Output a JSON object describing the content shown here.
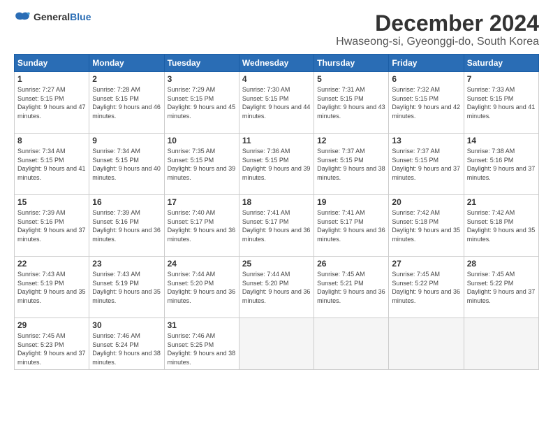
{
  "logo": {
    "general": "General",
    "blue": "Blue"
  },
  "title": "December 2024",
  "location": "Hwaseong-si, Gyeonggi-do, South Korea",
  "weekdays": [
    "Sunday",
    "Monday",
    "Tuesday",
    "Wednesday",
    "Thursday",
    "Friday",
    "Saturday"
  ],
  "weeks": [
    [
      {
        "day": "1",
        "sunrise": "7:27 AM",
        "sunset": "5:15 PM",
        "daylight": "9 hours and 47 minutes."
      },
      {
        "day": "2",
        "sunrise": "7:28 AM",
        "sunset": "5:15 PM",
        "daylight": "9 hours and 46 minutes."
      },
      {
        "day": "3",
        "sunrise": "7:29 AM",
        "sunset": "5:15 PM",
        "daylight": "9 hours and 45 minutes."
      },
      {
        "day": "4",
        "sunrise": "7:30 AM",
        "sunset": "5:15 PM",
        "daylight": "9 hours and 44 minutes."
      },
      {
        "day": "5",
        "sunrise": "7:31 AM",
        "sunset": "5:15 PM",
        "daylight": "9 hours and 43 minutes."
      },
      {
        "day": "6",
        "sunrise": "7:32 AM",
        "sunset": "5:15 PM",
        "daylight": "9 hours and 42 minutes."
      },
      {
        "day": "7",
        "sunrise": "7:33 AM",
        "sunset": "5:15 PM",
        "daylight": "9 hours and 41 minutes."
      }
    ],
    [
      {
        "day": "8",
        "sunrise": "7:34 AM",
        "sunset": "5:15 PM",
        "daylight": "9 hours and 41 minutes."
      },
      {
        "day": "9",
        "sunrise": "7:34 AM",
        "sunset": "5:15 PM",
        "daylight": "9 hours and 40 minutes."
      },
      {
        "day": "10",
        "sunrise": "7:35 AM",
        "sunset": "5:15 PM",
        "daylight": "9 hours and 39 minutes."
      },
      {
        "day": "11",
        "sunrise": "7:36 AM",
        "sunset": "5:15 PM",
        "daylight": "9 hours and 39 minutes."
      },
      {
        "day": "12",
        "sunrise": "7:37 AM",
        "sunset": "5:15 PM",
        "daylight": "9 hours and 38 minutes."
      },
      {
        "day": "13",
        "sunrise": "7:37 AM",
        "sunset": "5:15 PM",
        "daylight": "9 hours and 37 minutes."
      },
      {
        "day": "14",
        "sunrise": "7:38 AM",
        "sunset": "5:16 PM",
        "daylight": "9 hours and 37 minutes."
      }
    ],
    [
      {
        "day": "15",
        "sunrise": "7:39 AM",
        "sunset": "5:16 PM",
        "daylight": "9 hours and 37 minutes."
      },
      {
        "day": "16",
        "sunrise": "7:39 AM",
        "sunset": "5:16 PM",
        "daylight": "9 hours and 36 minutes."
      },
      {
        "day": "17",
        "sunrise": "7:40 AM",
        "sunset": "5:17 PM",
        "daylight": "9 hours and 36 minutes."
      },
      {
        "day": "18",
        "sunrise": "7:41 AM",
        "sunset": "5:17 PM",
        "daylight": "9 hours and 36 minutes."
      },
      {
        "day": "19",
        "sunrise": "7:41 AM",
        "sunset": "5:17 PM",
        "daylight": "9 hours and 36 minutes."
      },
      {
        "day": "20",
        "sunrise": "7:42 AM",
        "sunset": "5:18 PM",
        "daylight": "9 hours and 35 minutes."
      },
      {
        "day": "21",
        "sunrise": "7:42 AM",
        "sunset": "5:18 PM",
        "daylight": "9 hours and 35 minutes."
      }
    ],
    [
      {
        "day": "22",
        "sunrise": "7:43 AM",
        "sunset": "5:19 PM",
        "daylight": "9 hours and 35 minutes."
      },
      {
        "day": "23",
        "sunrise": "7:43 AM",
        "sunset": "5:19 PM",
        "daylight": "9 hours and 35 minutes."
      },
      {
        "day": "24",
        "sunrise": "7:44 AM",
        "sunset": "5:20 PM",
        "daylight": "9 hours and 36 minutes."
      },
      {
        "day": "25",
        "sunrise": "7:44 AM",
        "sunset": "5:20 PM",
        "daylight": "9 hours and 36 minutes."
      },
      {
        "day": "26",
        "sunrise": "7:45 AM",
        "sunset": "5:21 PM",
        "daylight": "9 hours and 36 minutes."
      },
      {
        "day": "27",
        "sunrise": "7:45 AM",
        "sunset": "5:22 PM",
        "daylight": "9 hours and 36 minutes."
      },
      {
        "day": "28",
        "sunrise": "7:45 AM",
        "sunset": "5:22 PM",
        "daylight": "9 hours and 37 minutes."
      }
    ],
    [
      {
        "day": "29",
        "sunrise": "7:45 AM",
        "sunset": "5:23 PM",
        "daylight": "9 hours and 37 minutes."
      },
      {
        "day": "30",
        "sunrise": "7:46 AM",
        "sunset": "5:24 PM",
        "daylight": "9 hours and 38 minutes."
      },
      {
        "day": "31",
        "sunrise": "7:46 AM",
        "sunset": "5:25 PM",
        "daylight": "9 hours and 38 minutes."
      },
      null,
      null,
      null,
      null
    ]
  ]
}
